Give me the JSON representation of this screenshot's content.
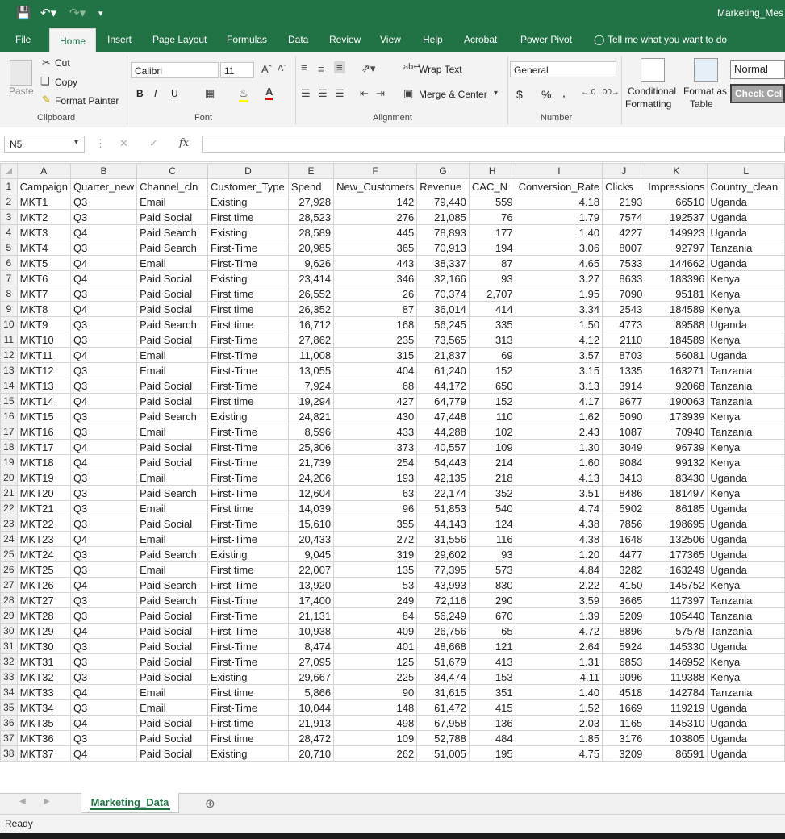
{
  "window": {
    "title": "Marketing_Mes"
  },
  "ribbon_tabs": [
    "File",
    "Home",
    "Insert",
    "Page Layout",
    "Formulas",
    "Data",
    "Review",
    "View",
    "Help",
    "Acrobat",
    "Power Pivot"
  ],
  "tell_me": "Tell me what you want to do",
  "clipboard": {
    "paste": "Paste",
    "cut": "Cut",
    "copy": "Copy",
    "format_painter": "Format Painter",
    "label": "Clipboard"
  },
  "font": {
    "name": "Calibri",
    "size": "11",
    "bold": "B",
    "italic": "I",
    "underline": "U",
    "label": "Font"
  },
  "alignment": {
    "wrap": "Wrap Text",
    "merge": "Merge & Center",
    "label": "Alignment"
  },
  "number": {
    "format": "General",
    "currency": "$",
    "percent": "%",
    "comma": ",",
    "label": "Number"
  },
  "styles": {
    "conditional": "Conditional",
    "conditional2": "Formatting",
    "format_as": "Format as",
    "format_as2": "Table",
    "normal": "Normal",
    "check": "Check Cell"
  },
  "namebox": "N5",
  "fx": "fx",
  "sheet": {
    "tab": "Marketing_Data",
    "status": "Ready"
  },
  "columns": [
    "A",
    "B",
    "C",
    "D",
    "E",
    "F",
    "G",
    "H",
    "I",
    "J",
    "K",
    "L"
  ],
  "headers": [
    "Campaign",
    "Quarter_new",
    "Channel_cln",
    "Customer_Type",
    "Spend",
    "New_Customers",
    "Revenue",
    "CAC_N",
    "Conversion_Rate",
    "Clicks",
    "Impressions",
    "Country_clean"
  ],
  "rows": [
    [
      "MKT1",
      "Q3",
      "Email",
      "Existing",
      "27,928",
      "142",
      "79,440",
      "559",
      "4.18",
      "2193",
      "66510",
      "Uganda"
    ],
    [
      "MKT2",
      "Q3",
      "Paid Social",
      "First time",
      "28,523",
      "276",
      "21,085",
      "76",
      "1.79",
      "7574",
      "192537",
      "Uganda"
    ],
    [
      "MKT3",
      "Q4",
      "Paid Search",
      "Existing",
      "28,589",
      "445",
      "78,893",
      "177",
      "1.40",
      "4227",
      "149923",
      "Uganda"
    ],
    [
      "MKT4",
      "Q3",
      "Paid Search",
      "First-Time",
      "20,985",
      "365",
      "70,913",
      "194",
      "3.06",
      "8007",
      "92797",
      "Tanzania"
    ],
    [
      "MKT5",
      "Q4",
      "Email",
      "First-Time",
      "9,626",
      "443",
      "38,337",
      "87",
      "4.65",
      "7533",
      "144662",
      "Uganda"
    ],
    [
      "MKT6",
      "Q4",
      "Paid Social",
      "Existing",
      "23,414",
      "346",
      "32,166",
      "93",
      "3.27",
      "8633",
      "183396",
      "Kenya"
    ],
    [
      "MKT7",
      "Q3",
      "Paid Social",
      "First time",
      "26,552",
      "26",
      "70,374",
      "2,707",
      "1.95",
      "7090",
      "95181",
      "Kenya"
    ],
    [
      "MKT8",
      "Q4",
      "Paid Social",
      "First time",
      "26,352",
      "87",
      "36,014",
      "414",
      "3.34",
      "2543",
      "184589",
      "Kenya"
    ],
    [
      "MKT9",
      "Q3",
      "Paid Search",
      "First time",
      "16,712",
      "168",
      "56,245",
      "335",
      "1.50",
      "4773",
      "89588",
      "Uganda"
    ],
    [
      "MKT10",
      "Q3",
      "Paid Social",
      "First-Time",
      "27,862",
      "235",
      "73,565",
      "313",
      "4.12",
      "2110",
      "184589",
      "Kenya"
    ],
    [
      "MKT11",
      "Q4",
      "Email",
      "First-Time",
      "11,008",
      "315",
      "21,837",
      "69",
      "3.57",
      "8703",
      "56081",
      "Uganda"
    ],
    [
      "MKT12",
      "Q3",
      "Email",
      "First-Time",
      "13,055",
      "404",
      "61,240",
      "152",
      "3.15",
      "1335",
      "163271",
      "Tanzania"
    ],
    [
      "MKT13",
      "Q3",
      "Paid Social",
      "First-Time",
      "7,924",
      "68",
      "44,172",
      "650",
      "3.13",
      "3914",
      "92068",
      "Tanzania"
    ],
    [
      "MKT14",
      "Q4",
      "Paid Social",
      "First time",
      "19,294",
      "427",
      "64,779",
      "152",
      "4.17",
      "9677",
      "190063",
      "Tanzania"
    ],
    [
      "MKT15",
      "Q3",
      "Paid Search",
      "Existing",
      "24,821",
      "430",
      "47,448",
      "110",
      "1.62",
      "5090",
      "173939",
      "Kenya"
    ],
    [
      "MKT16",
      "Q3",
      "Email",
      "First-Time",
      "8,596",
      "433",
      "44,288",
      "102",
      "2.43",
      "1087",
      "70940",
      "Tanzania"
    ],
    [
      "MKT17",
      "Q4",
      "Paid Social",
      "First-Time",
      "25,306",
      "373",
      "40,557",
      "109",
      "1.30",
      "3049",
      "96739",
      "Kenya"
    ],
    [
      "MKT18",
      "Q4",
      "Paid Social",
      "First-Time",
      "21,739",
      "254",
      "54,443",
      "214",
      "1.60",
      "9084",
      "99132",
      "Kenya"
    ],
    [
      "MKT19",
      "Q3",
      "Email",
      "First-Time",
      "24,206",
      "193",
      "42,135",
      "218",
      "4.13",
      "3413",
      "83430",
      "Uganda"
    ],
    [
      "MKT20",
      "Q3",
      "Paid Search",
      "First-Time",
      "12,604",
      "63",
      "22,174",
      "352",
      "3.51",
      "8486",
      "181497",
      "Kenya"
    ],
    [
      "MKT21",
      "Q3",
      "Email",
      "First time",
      "14,039",
      "96",
      "51,853",
      "540",
      "4.74",
      "5902",
      "86185",
      "Uganda"
    ],
    [
      "MKT22",
      "Q3",
      "Paid Social",
      "First-Time",
      "15,610",
      "355",
      "44,143",
      "124",
      "4.38",
      "7856",
      "198695",
      "Uganda"
    ],
    [
      "MKT23",
      "Q4",
      "Email",
      "First-Time",
      "20,433",
      "272",
      "31,556",
      "116",
      "4.38",
      "1648",
      "132506",
      "Uganda"
    ],
    [
      "MKT24",
      "Q3",
      "Paid Search",
      "Existing",
      "9,045",
      "319",
      "29,602",
      "93",
      "1.20",
      "4477",
      "177365",
      "Uganda"
    ],
    [
      "MKT25",
      "Q3",
      "Email",
      "First time",
      "22,007",
      "135",
      "77,395",
      "573",
      "4.84",
      "3282",
      "163249",
      "Uganda"
    ],
    [
      "MKT26",
      "Q4",
      "Paid Search",
      "First-Time",
      "13,920",
      "53",
      "43,993",
      "830",
      "2.22",
      "4150",
      "145752",
      "Kenya"
    ],
    [
      "MKT27",
      "Q3",
      "Paid Search",
      "First-Time",
      "17,400",
      "249",
      "72,116",
      "290",
      "3.59",
      "3665",
      "117397",
      "Tanzania"
    ],
    [
      "MKT28",
      "Q3",
      "Paid Social",
      "First-Time",
      "21,131",
      "84",
      "56,249",
      "670",
      "1.39",
      "5209",
      "105440",
      "Tanzania"
    ],
    [
      "MKT29",
      "Q4",
      "Paid Social",
      "First-Time",
      "10,938",
      "409",
      "26,756",
      "65",
      "4.72",
      "8896",
      "57578",
      "Tanzania"
    ],
    [
      "MKT30",
      "Q3",
      "Paid Social",
      "First-Time",
      "8,474",
      "401",
      "48,668",
      "121",
      "2.64",
      "5924",
      "145330",
      "Uganda"
    ],
    [
      "MKT31",
      "Q3",
      "Paid Social",
      "First-Time",
      "27,095",
      "125",
      "51,679",
      "413",
      "1.31",
      "6853",
      "146952",
      "Kenya"
    ],
    [
      "MKT32",
      "Q3",
      "Paid Social",
      "Existing",
      "29,667",
      "225",
      "34,474",
      "153",
      "4.11",
      "9096",
      "119388",
      "Kenya"
    ],
    [
      "MKT33",
      "Q4",
      "Email",
      "First time",
      "5,866",
      "90",
      "31,615",
      "351",
      "1.40",
      "4518",
      "142784",
      "Tanzania"
    ],
    [
      "MKT34",
      "Q3",
      "Email",
      "First-Time",
      "10,044",
      "148",
      "61,472",
      "415",
      "1.52",
      "1669",
      "119219",
      "Uganda"
    ],
    [
      "MKT35",
      "Q4",
      "Paid Social",
      "First time",
      "21,913",
      "498",
      "67,958",
      "136",
      "2.03",
      "1165",
      "145310",
      "Uganda"
    ],
    [
      "MKT36",
      "Q3",
      "Paid Social",
      "First time",
      "28,472",
      "109",
      "52,788",
      "484",
      "1.85",
      "3176",
      "103805",
      "Uganda"
    ],
    [
      "MKT37",
      "Q4",
      "Paid Social",
      "Existing",
      "20,710",
      "262",
      "51,005",
      "195",
      "4.75",
      "3209",
      "86591",
      "Uganda"
    ]
  ],
  "colors": {
    "brand": "#217346",
    "header_bg": "#f0f0f0",
    "grid": "#d4d4d4"
  }
}
